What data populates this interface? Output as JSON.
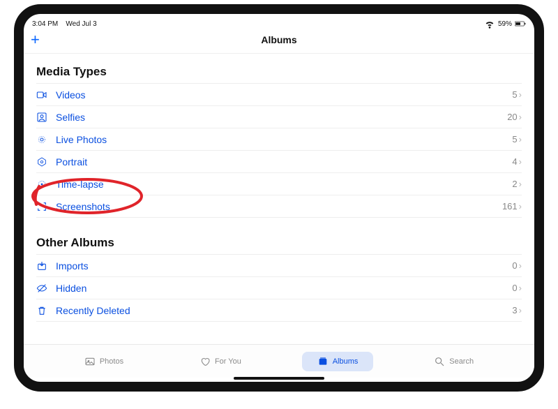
{
  "status": {
    "time": "3:04 PM",
    "date": "Wed Jul 3",
    "battery": "59%"
  },
  "nav": {
    "add_label": "+",
    "title": "Albums"
  },
  "sections": {
    "media_types": {
      "header": "Media Types",
      "items": [
        {
          "icon": "video",
          "label": "Videos",
          "count": "5"
        },
        {
          "icon": "selfie",
          "label": "Selfies",
          "count": "20"
        },
        {
          "icon": "livephoto",
          "label": "Live Photos",
          "count": "5"
        },
        {
          "icon": "portrait",
          "label": "Portrait",
          "count": "4"
        },
        {
          "icon": "timelapse",
          "label": "Time-lapse",
          "count": "2"
        },
        {
          "icon": "screenshot",
          "label": "Screenshots",
          "count": "161"
        }
      ]
    },
    "other_albums": {
      "header": "Other Albums",
      "items": [
        {
          "icon": "imports",
          "label": "Imports",
          "count": "0"
        },
        {
          "icon": "hidden",
          "label": "Hidden",
          "count": "0"
        },
        {
          "icon": "trash",
          "label": "Recently Deleted",
          "count": "3"
        }
      ]
    }
  },
  "tabs": [
    {
      "icon": "photos",
      "label": "Photos",
      "active": false
    },
    {
      "icon": "foryou",
      "label": "For You",
      "active": false
    },
    {
      "icon": "albums",
      "label": "Albums",
      "active": true
    },
    {
      "icon": "search",
      "label": "Search",
      "active": false
    }
  ],
  "chevron": "›",
  "annotation": {
    "highlighted_item": "Time-lapse",
    "color": "#e0242a"
  }
}
